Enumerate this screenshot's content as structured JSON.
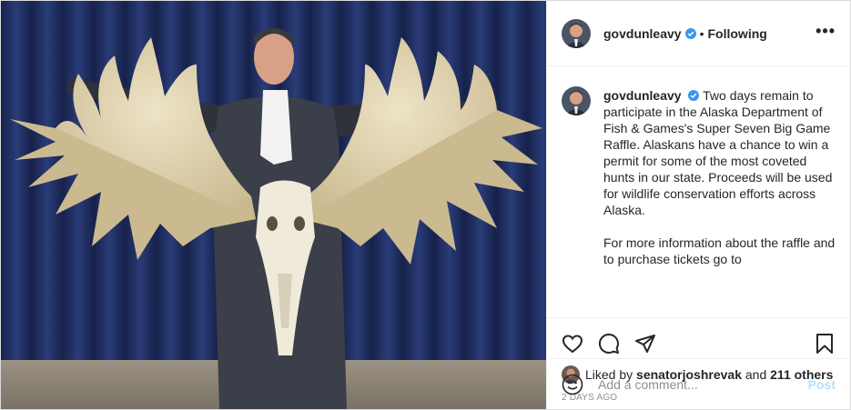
{
  "post": {
    "username": "govdunleavy",
    "separator": "•",
    "follow_status": "Following",
    "more_glyph": "•••",
    "caption_intro": "Two days remain to participate in the Alaska Department of Fish & Games's Super Seven Big Game Raffle. Alaskans have a chance to win a permit for some of the most coveted hunts in our state. Proceeds will be used for wildlife conservation efforts across Alaska.",
    "caption_more": "For more information about the raffle and to purchase tickets go to",
    "liked_by_prefix": "Liked by",
    "liked_by_user": "senatorjoshrevak",
    "liked_by_and": "and",
    "liked_by_others": "211 others",
    "timestamp": "2 DAYS AGO",
    "comment_placeholder": "Add a comment...",
    "post_button": "Post"
  },
  "icons": {
    "verified": "verified-badge-icon",
    "like": "heart-icon",
    "comment": "comment-bubble-icon",
    "share": "paper-plane-icon",
    "save": "bookmark-icon",
    "emoji": "smiley-icon"
  },
  "colors": {
    "verified_blue": "#3897f0",
    "post_button_disabled": "#b2dffc",
    "muted_text": "#8e8e8e",
    "curtain_blue": "#1e2d5e"
  }
}
